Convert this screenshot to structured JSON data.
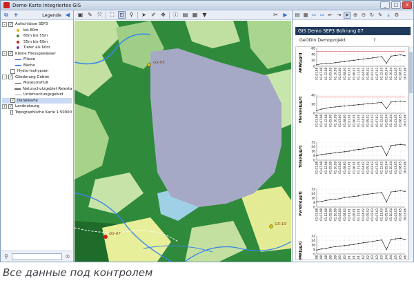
{
  "window": {
    "title": "Demo-Karte Integriertes GIS"
  },
  "legend": {
    "title": "Legende",
    "items": [
      {
        "label": "Aufschlüsse SEP3",
        "level": 0,
        "expand": "-",
        "checked": true
      },
      {
        "label": "bis 60m",
        "level": 2,
        "color": "#d9b700"
      },
      {
        "label": "60m bis 55m",
        "level": 2,
        "color": "#4a8a2a"
      },
      {
        "label": "55m bis 60m",
        "level": 2,
        "color": "#c21a1a"
      },
      {
        "label": "Tiefer als 60m",
        "level": 2,
        "color": "#7a3cb0"
      },
      {
        "label": "Kleine Fliessgewässer",
        "level": 0,
        "expand": "-",
        "checked": true
      },
      {
        "label": "Flüsse",
        "level": 2,
        "line": "#2060c0"
      },
      {
        "label": "Bäche",
        "level": 2,
        "line": "#4a90e0"
      },
      {
        "label": "Hydro-Isohypsen",
        "level": 1,
        "checked": false
      },
      {
        "label": "Gliederung Gebiet",
        "level": 0,
        "expand": "-",
        "checked": true
      },
      {
        "label": "Museumsfluß",
        "level": 2,
        "line": "#333333"
      },
      {
        "label": "Naturschutzgebiet Reiestadt",
        "level": 2,
        "line": "#666666"
      },
      {
        "label": "Untersuchungsgebiet",
        "level": 2,
        "line": "#999999"
      },
      {
        "label": "Detailkarte",
        "level": 1,
        "checked": true,
        "selected": true
      },
      {
        "label": "Landnutzung",
        "level": 0,
        "expand": "+",
        "checked": true
      },
      {
        "label": "Topographische Karte 1:50000",
        "level": 1,
        "checked": false
      }
    ]
  },
  "map": {
    "labels": [
      {
        "text": "GS-05"
      },
      {
        "text": "GS-07"
      },
      {
        "text": "GS-10"
      }
    ]
  },
  "report": {
    "header": "GIS Demo SEP3 Bohrung 07",
    "project": "GeODin Demoprojekt",
    "page": "?"
  },
  "chart_data": [
    {
      "type": "line",
      "ylabel": "AKW[µg/l]",
      "yticks": [
        "60",
        "40",
        "20",
        "0"
      ],
      "ylim": [
        0,
        60
      ],
      "x": [
        "01.01.98",
        "01.07.98",
        "01.12.98",
        "01.05.99",
        "01.10.99",
        "01.03.00",
        "01.08.00",
        "01.01.01",
        "01.06.01",
        "01.11.01",
        "01.04.02",
        "01.09.02",
        "01.02.03",
        "01.07.03",
        "01.12.03",
        "01.05.04",
        "01.10.04",
        "01.03.05",
        "01.08.05",
        "30.03.06"
      ],
      "values": [
        5,
        8,
        9,
        10,
        12,
        14,
        16,
        18,
        20,
        22,
        24,
        26,
        28,
        30,
        32,
        10,
        34,
        36,
        38,
        35
      ],
      "threshold": 50
    },
    {
      "type": "line",
      "ylabel": "Phenole[µg/l]",
      "yticks": [
        "40",
        "20",
        "0"
      ],
      "ylim": [
        0,
        40
      ],
      "x": [
        "01.01.98",
        "01.07.98",
        "01.12.98",
        "01.05.99",
        "01.10.99",
        "01.03.00",
        "01.08.00",
        "01.01.01",
        "01.06.01",
        "01.11.01",
        "01.04.02",
        "01.09.02",
        "01.02.03",
        "01.07.03",
        "01.12.03",
        "01.05.04",
        "01.10.04",
        "01.03.05",
        "01.08.05",
        "30.03.06"
      ],
      "values": [
        6,
        9,
        11,
        13,
        14,
        15,
        16,
        17,
        18,
        19,
        20,
        21,
        22,
        23,
        24,
        10,
        25,
        26,
        27,
        26
      ],
      "threshold": 36
    },
    {
      "type": "line",
      "ylabel": "Toluol[µg/l]",
      "yticks": [
        "32",
        "24",
        "16",
        "8",
        "0"
      ],
      "ylim": [
        0,
        32
      ],
      "x": [
        "01.01.98",
        "01.07.98",
        "01.12.98",
        "01.05.99",
        "01.10.99",
        "01.03.00",
        "01.08.00",
        "01.01.01",
        "01.06.01",
        "01.11.01",
        "01.04.02",
        "01.09.02",
        "01.02.03",
        "01.07.03",
        "01.12.03",
        "01.05.04",
        "01.10.04",
        "01.03.05",
        "01.08.05",
        "30.03.06"
      ],
      "values": [
        8,
        10,
        11,
        12,
        13,
        14,
        15,
        16,
        18,
        19,
        20,
        22,
        23,
        24,
        25,
        8,
        26,
        27,
        28,
        27
      ]
    },
    {
      "type": "line",
      "ylabel": "Pyridin[µg/l]",
      "yticks": [
        "32",
        "24",
        "16",
        "8",
        "0"
      ],
      "ylim": [
        0,
        32
      ],
      "x": [
        "01.01.98",
        "01.07.98",
        "01.12.98",
        "01.05.99",
        "01.10.99",
        "01.03.00",
        "01.08.00",
        "01.01.01",
        "01.06.01",
        "01.11.01",
        "01.04.02",
        "01.09.02",
        "01.02.03",
        "01.07.03",
        "01.12.03",
        "01.05.04",
        "01.10.04",
        "01.03.05",
        "01.08.05",
        "30.03.06"
      ],
      "values": [
        9,
        10,
        12,
        13,
        14,
        15,
        17,
        18,
        19,
        20,
        22,
        23,
        24,
        25,
        26,
        9,
        27,
        28,
        29,
        28
      ]
    },
    {
      "type": "line",
      "ylabel": "PAK[µg/l]",
      "yticks": [
        "32",
        "24",
        "16",
        "8",
        "0"
      ],
      "ylim": [
        0,
        32
      ],
      "x": [
        "01.01.98",
        "01.07.98",
        "01.12.98",
        "01.05.99",
        "01.10.99",
        "01.03.00",
        "01.08.00",
        "01.01.01",
        "01.06.01",
        "01.11.01",
        "01.04.02",
        "01.09.02",
        "01.02.03",
        "01.07.03",
        "01.12.03",
        "01.05.04",
        "01.10.04",
        "01.03.05",
        "01.08.05",
        "30.03.06"
      ],
      "values": [
        7,
        9,
        10,
        12,
        13,
        14,
        15,
        16,
        17,
        19,
        20,
        21,
        22,
        24,
        25,
        8,
        26,
        27,
        28,
        26
      ]
    }
  ],
  "caption": "Все данные под контролем"
}
